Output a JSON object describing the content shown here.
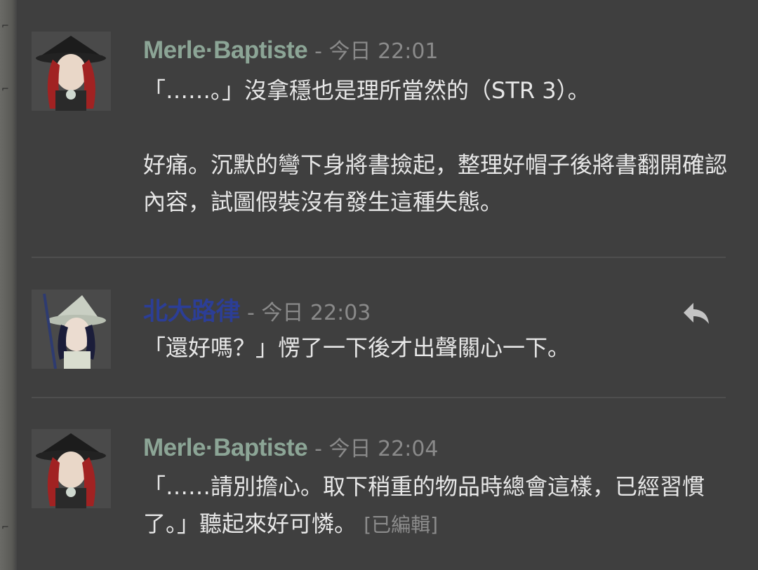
{
  "colors": {
    "merle_name": "#8ca596",
    "beida_name": "#2c3e96",
    "timestamp": "#8a8a8a",
    "message_text": "#e7e7e7",
    "background": "#3f3f3f"
  },
  "messages": [
    {
      "author": "Merle·Baptiste",
      "meta": "- 今日 22:01",
      "text": "「……。」沒拿穩也是理所當然的（STR 3）。\n\n好痛。沉默的彎下身將書撿起，整理好帽子後將書翻開確認內容，試圖假裝沒有發生這種失態。",
      "edited": ""
    },
    {
      "author": "北大路律",
      "meta": "- 今日 22:03",
      "text": "「還好嗎？」愣了一下後才出聲關心一下。",
      "edited": ""
    },
    {
      "author": "Merle·Baptiste",
      "meta": "- 今日 22:04",
      "text": "「……請別擔心。取下稍重的物品時總會這樣，已經習慣了。」聽起來好可憐。 ",
      "edited": "[已編輯]"
    }
  ],
  "reply_icon": "reply-arrow-icon"
}
